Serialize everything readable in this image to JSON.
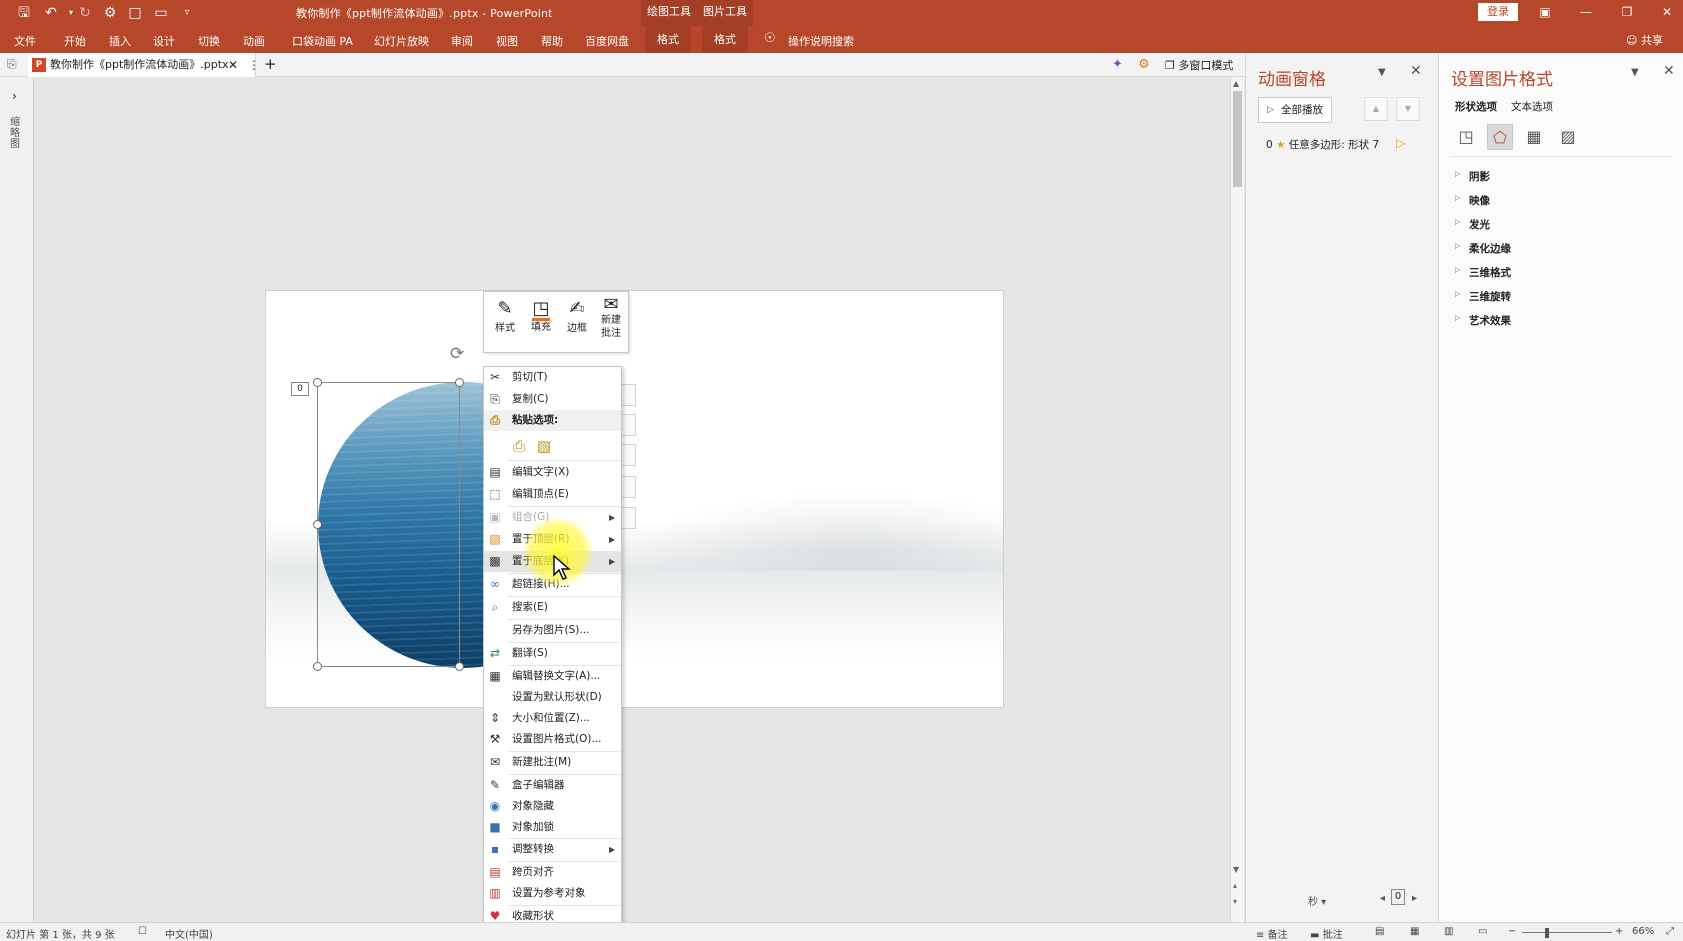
{
  "titlebar": {
    "file_title": "教你制作《ppt制作流体动画》.pptx  -  PowerPoint",
    "context_tools": [
      "绘图工具",
      "图片工具"
    ],
    "login_label": "登录",
    "qa_icons": [
      "save-icon",
      "undo-icon",
      "redo-icon",
      "slideshow-icon",
      "new-file-icon",
      "open-icon",
      "customize-icon"
    ],
    "window_buttons": [
      "ribbon-display-icon",
      "minimize-icon",
      "restore-icon",
      "close-icon"
    ]
  },
  "ribbon": {
    "tabs": [
      "文件",
      "开始",
      "插入",
      "设计",
      "切换",
      "动画",
      "口袋动画 PA",
      "幻灯片放映",
      "审阅",
      "视图",
      "帮助",
      "百度网盘"
    ],
    "context_tabs": [
      "格式",
      "格式"
    ],
    "search_label": "操作说明搜索",
    "share_label": "共享"
  },
  "tabstrip": {
    "doc_tab": "教你制作《ppt制作流体动画》.pptx",
    "multiwindow_label": "多窗口模式"
  },
  "leftbar": {
    "label": "缩略图"
  },
  "slide": {
    "anim_badge": "0"
  },
  "minibar": {
    "buttons": [
      {
        "label": "样式",
        "icon": "style-icon"
      },
      {
        "label": "填充",
        "icon": "fill-icon"
      },
      {
        "label": "边框",
        "icon": "outline-icon"
      },
      {
        "label": "新建\n批注",
        "icon": "new-comment-icon"
      }
    ],
    "fill_color": "#e8711a"
  },
  "context_menu": {
    "items": [
      {
        "label": "剪切(T)",
        "icon": "cut-icon"
      },
      {
        "label": "复制(C)",
        "icon": "copy-icon"
      },
      {
        "label": "粘贴选项:",
        "icon": "paste-icon"
      },
      {
        "label": "编辑文字(X)",
        "icon": "edit-text-icon"
      },
      {
        "label": "编辑顶点(E)",
        "icon": "edit-points-icon"
      },
      {
        "label": "组合(G)",
        "icon": "group-icon"
      },
      {
        "label": "置于顶层(R)",
        "icon": "bring-front-icon"
      },
      {
        "label": "置于底层(K)",
        "icon": "send-back-icon"
      },
      {
        "label": "超链接(H)...",
        "icon": "link-icon"
      },
      {
        "label": "搜索(E)",
        "icon": "search-icon"
      },
      {
        "label": "另存为图片(S)...",
        "icon": ""
      },
      {
        "label": "翻译(S)",
        "icon": "translate-icon"
      },
      {
        "label": "编辑替换文字(A)...",
        "icon": "alt-text-icon"
      },
      {
        "label": "设置为默认形状(D)",
        "icon": ""
      },
      {
        "label": "大小和位置(Z)...",
        "icon": "size-position-icon"
      },
      {
        "label": "设置图片格式(O)...",
        "icon": "format-picture-icon"
      },
      {
        "label": "新建批注(M)",
        "icon": "new-comment-icon"
      },
      {
        "label": "盒子编辑器",
        "icon": "box-editor-icon"
      },
      {
        "label": "对象隐藏",
        "icon": "hide-icon"
      },
      {
        "label": "对象加锁",
        "icon": "lock-icon"
      },
      {
        "label": "调整转换",
        "icon": "convert-icon"
      },
      {
        "label": "跨页对齐",
        "icon": "align-pages-icon"
      },
      {
        "label": "设置为参考对象",
        "icon": "reference-icon"
      },
      {
        "label": "收藏形状",
        "icon": "favorite-icon"
      }
    ]
  },
  "animation_pane": {
    "title": "动画窗格",
    "play_all": "全部播放",
    "item_index": "0",
    "item_label": "任意多边形: 形状 7",
    "seconds_label": "秒",
    "zoom_value": "0"
  },
  "format_pane": {
    "title": "设置图片格式",
    "option_tabs": [
      "形状选项",
      "文本选项"
    ],
    "category_icons": [
      "fill-line-icon",
      "effects-icon",
      "size-properties-icon",
      "picture-icon"
    ],
    "sections": [
      "阴影",
      "映像",
      "发光",
      "柔化边缘",
      "三维格式",
      "三维旋转",
      "艺术效果"
    ]
  },
  "statusbar": {
    "slide_info": "幻灯片 第 1 张，共 9 张",
    "language": "中文(中国)",
    "notes_label": "备注",
    "comments_label": "批注",
    "zoom": "66%"
  }
}
